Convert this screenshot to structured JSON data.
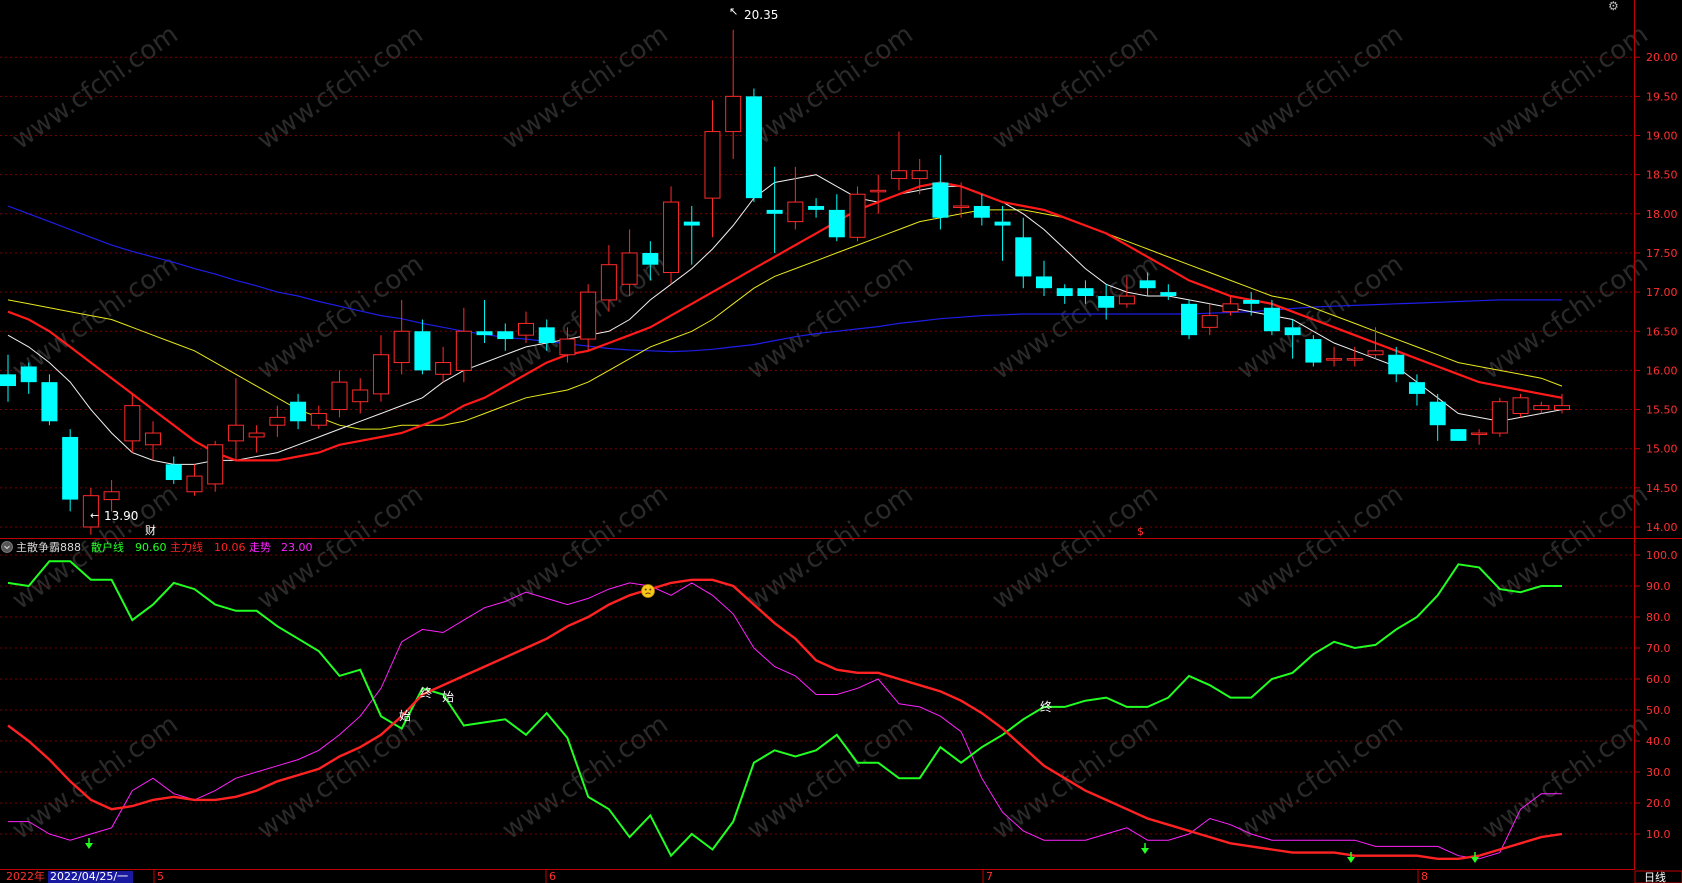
{
  "price_panel": {
    "max_label": "20.35",
    "min_label": "13.90",
    "finance_marker": "财",
    "dollar_marker": "$"
  },
  "indicator_panel": {
    "name": "主散争霸888",
    "legend": [
      {
        "label": "散户线",
        "value": "90.60",
        "color": "#22ff22"
      },
      {
        "label": "主力线",
        "value": "10.06",
        "color": "#ff2222"
      },
      {
        "label": "走势",
        "value": "23.00",
        "color": "#ff22ff"
      }
    ],
    "start_marker": "始",
    "end_marker": "终"
  },
  "time_axis": {
    "year_label": "2022年",
    "cursor_date": "2022/04/25/一",
    "month_labels": [
      "5",
      "6",
      "7",
      "8"
    ],
    "period": "日线"
  },
  "colors": {
    "up": "#ff2a2a",
    "down": "#00ffff",
    "ma5": "#f0f0f0",
    "ma10": "#ff1a1a",
    "ma20": "#e8e81a",
    "ma60": "#1e1ee8",
    "retail": "#22ff22",
    "main": "#ff2222",
    "trend": "#ff22ff",
    "axis": "#c00000"
  },
  "chart_data": [
    {
      "type": "candlestick",
      "y_ticks": [
        14.0,
        14.5,
        15.0,
        15.5,
        16.0,
        16.5,
        17.0,
        17.5,
        18.0,
        18.5,
        19.0,
        19.5,
        20.0
      ],
      "ylim": [
        13.65,
        20.45
      ],
      "candles": [
        [
          15.95,
          15.8,
          16.2,
          15.6
        ],
        [
          16.05,
          15.85,
          16.1,
          15.7
        ],
        [
          15.85,
          15.35,
          15.95,
          15.3
        ],
        [
          15.15,
          14.35,
          15.25,
          14.2
        ],
        [
          14.0,
          14.4,
          14.5,
          13.9
        ],
        [
          14.35,
          14.45,
          14.6,
          14.2
        ],
        [
          15.1,
          15.55,
          15.7,
          14.95
        ],
        [
          15.05,
          15.2,
          15.35,
          14.85
        ],
        [
          14.8,
          14.6,
          14.9,
          14.55
        ],
        [
          14.45,
          14.65,
          14.8,
          14.4
        ],
        [
          14.55,
          15.05,
          15.1,
          14.45
        ],
        [
          15.1,
          15.3,
          15.9,
          14.85
        ],
        [
          15.15,
          15.2,
          15.3,
          14.95
        ],
        [
          15.3,
          15.4,
          15.55,
          15.15
        ],
        [
          15.6,
          15.35,
          15.7,
          15.25
        ],
        [
          15.3,
          15.45,
          15.55,
          15.25
        ],
        [
          15.5,
          15.85,
          16.0,
          15.4
        ],
        [
          15.6,
          15.75,
          15.9,
          15.45
        ],
        [
          15.7,
          16.2,
          16.45,
          15.6
        ],
        [
          16.1,
          16.5,
          16.9,
          15.95
        ],
        [
          16.5,
          16.0,
          16.65,
          15.95
        ],
        [
          15.95,
          16.1,
          16.3,
          15.85
        ],
        [
          16.0,
          16.5,
          16.8,
          15.85
        ],
        [
          16.5,
          16.45,
          16.9,
          16.35
        ],
        [
          16.5,
          16.4,
          16.6,
          16.25
        ],
        [
          16.45,
          16.6,
          16.75,
          16.35
        ],
        [
          16.55,
          16.35,
          16.65,
          16.25
        ],
        [
          16.2,
          16.4,
          16.55,
          16.1
        ],
        [
          16.4,
          17.0,
          17.1,
          16.25
        ],
        [
          16.9,
          17.35,
          17.6,
          16.75
        ],
        [
          17.1,
          17.5,
          17.8,
          16.95
        ],
        [
          17.5,
          17.35,
          17.65,
          17.15
        ],
        [
          17.25,
          18.15,
          18.35,
          17.1
        ],
        [
          17.9,
          17.85,
          18.1,
          17.35
        ],
        [
          18.2,
          19.05,
          19.45,
          17.7
        ],
        [
          19.05,
          19.5,
          20.35,
          18.7
        ],
        [
          19.5,
          18.2,
          19.6,
          18.15
        ],
        [
          18.05,
          18.0,
          18.6,
          17.5
        ],
        [
          17.9,
          18.15,
          18.6,
          17.8
        ],
        [
          18.1,
          18.05,
          18.2,
          17.95
        ],
        [
          18.05,
          17.7,
          18.25,
          17.65
        ],
        [
          17.7,
          18.25,
          18.35,
          17.65
        ],
        [
          18.3,
          18.3,
          18.5,
          18.0
        ],
        [
          18.45,
          18.55,
          19.05,
          18.3
        ],
        [
          18.45,
          18.55,
          18.7,
          18.25
        ],
        [
          18.4,
          17.95,
          18.75,
          17.8
        ],
        [
          18.1,
          18.1,
          18.4,
          17.95
        ],
        [
          18.1,
          17.95,
          18.25,
          17.85
        ],
        [
          17.9,
          17.85,
          18.1,
          17.4
        ],
        [
          17.7,
          17.2,
          17.95,
          17.05
        ],
        [
          17.2,
          17.05,
          17.4,
          16.95
        ],
        [
          17.05,
          16.95,
          17.1,
          16.85
        ],
        [
          17.05,
          16.95,
          17.15,
          16.85
        ],
        [
          16.95,
          16.8,
          17.1,
          16.65
        ],
        [
          16.85,
          16.95,
          17.2,
          16.8
        ],
        [
          17.15,
          17.05,
          17.25,
          16.95
        ],
        [
          17.0,
          16.95,
          17.1,
          16.9
        ],
        [
          16.85,
          16.45,
          16.9,
          16.4
        ],
        [
          16.55,
          16.7,
          16.85,
          16.45
        ],
        [
          16.75,
          16.85,
          16.95,
          16.7
        ],
        [
          16.9,
          16.85,
          17.0,
          16.7
        ],
        [
          16.8,
          16.5,
          16.9,
          16.45
        ],
        [
          16.55,
          16.45,
          16.65,
          16.15
        ],
        [
          16.4,
          16.1,
          16.45,
          16.05
        ],
        [
          16.15,
          16.15,
          16.3,
          16.05
        ],
        [
          16.15,
          16.15,
          16.3,
          16.05
        ],
        [
          16.2,
          16.25,
          16.55,
          16.15
        ],
        [
          16.2,
          15.95,
          16.3,
          15.85
        ],
        [
          15.85,
          15.7,
          15.95,
          15.55
        ],
        [
          15.6,
          15.3,
          15.7,
          15.1
        ],
        [
          15.25,
          15.1,
          15.25,
          15.1
        ],
        [
          15.2,
          15.2,
          15.25,
          15.05
        ],
        [
          15.2,
          15.6,
          15.65,
          15.15
        ],
        [
          15.45,
          15.65,
          15.7,
          15.4
        ],
        [
          15.5,
          15.55,
          15.6,
          15.45
        ],
        [
          15.5,
          15.55,
          15.7,
          15.45
        ]
      ],
      "series": [
        {
          "name": "MA5",
          "values": [
            16.45,
            16.3,
            16.1,
            15.85,
            15.5,
            15.2,
            14.95,
            14.85,
            14.8,
            14.8,
            14.85,
            14.85,
            14.9,
            14.95,
            15.05,
            15.15,
            15.25,
            15.35,
            15.45,
            15.55,
            15.65,
            15.85,
            16.0,
            16.1,
            16.2,
            16.3,
            16.35,
            16.4,
            16.45,
            16.5,
            16.65,
            16.9,
            17.1,
            17.3,
            17.55,
            17.85,
            18.2,
            18.4,
            18.45,
            18.5,
            18.35,
            18.2,
            18.15,
            18.25,
            18.3,
            18.35,
            18.35,
            18.25,
            18.15,
            18.0,
            17.8,
            17.55,
            17.3,
            17.1,
            17.0,
            16.95,
            16.95,
            16.9,
            16.85,
            16.8,
            16.75,
            16.7,
            16.65,
            16.5,
            16.35,
            16.25,
            16.15,
            16.05,
            15.85,
            15.65,
            15.45,
            15.4,
            15.35,
            15.4,
            15.45,
            15.5
          ]
        },
        {
          "name": "MA10",
          "values": [
            16.75,
            16.65,
            16.5,
            16.3,
            16.1,
            15.9,
            15.7,
            15.5,
            15.3,
            15.1,
            14.95,
            14.85,
            14.85,
            14.85,
            14.9,
            14.95,
            15.05,
            15.1,
            15.15,
            15.2,
            15.3,
            15.4,
            15.55,
            15.65,
            15.8,
            15.95,
            16.1,
            16.2,
            16.25,
            16.35,
            16.45,
            16.55,
            16.7,
            16.85,
            17.0,
            17.15,
            17.3,
            17.45,
            17.6,
            17.75,
            17.9,
            18.05,
            18.15,
            18.25,
            18.35,
            18.4,
            18.35,
            18.25,
            18.15,
            18.1,
            18.05,
            17.95,
            17.85,
            17.75,
            17.6,
            17.45,
            17.3,
            17.15,
            17.05,
            16.95,
            16.9,
            16.85,
            16.75,
            16.65,
            16.55,
            16.45,
            16.35,
            16.25,
            16.15,
            16.05,
            15.95,
            15.85,
            15.8,
            15.75,
            15.7,
            15.65
          ]
        },
        {
          "name": "MA20",
          "values": [
            16.9,
            16.85,
            16.8,
            16.75,
            16.7,
            16.65,
            16.55,
            16.45,
            16.35,
            16.25,
            16.1,
            15.95,
            15.8,
            15.65,
            15.5,
            15.4,
            15.3,
            15.25,
            15.25,
            15.3,
            15.3,
            15.3,
            15.35,
            15.45,
            15.55,
            15.65,
            15.7,
            15.75,
            15.85,
            16.0,
            16.15,
            16.3,
            16.4,
            16.5,
            16.65,
            16.85,
            17.05,
            17.2,
            17.3,
            17.4,
            17.5,
            17.6,
            17.7,
            17.8,
            17.9,
            17.95,
            18.0,
            18.05,
            18.05,
            18.05,
            18.0,
            17.95,
            17.85,
            17.75,
            17.65,
            17.55,
            17.45,
            17.35,
            17.25,
            17.15,
            17.05,
            16.95,
            16.9,
            16.8,
            16.7,
            16.6,
            16.5,
            16.4,
            16.3,
            16.2,
            16.1,
            16.05,
            16.0,
            15.95,
            15.9,
            15.8
          ]
        },
        {
          "name": "MA60",
          "values": [
            18.1,
            18.0,
            17.9,
            17.8,
            17.7,
            17.6,
            17.52,
            17.45,
            17.38,
            17.3,
            17.23,
            17.15,
            17.08,
            17.0,
            16.95,
            16.88,
            16.82,
            16.76,
            16.7,
            16.66,
            16.6,
            16.55,
            16.5,
            16.46,
            16.42,
            16.4,
            16.37,
            16.34,
            16.31,
            16.28,
            16.26,
            16.25,
            16.24,
            16.25,
            16.27,
            16.3,
            16.33,
            16.38,
            16.43,
            16.47,
            16.5,
            16.53,
            16.56,
            16.6,
            16.63,
            16.66,
            16.68,
            16.7,
            16.71,
            16.72,
            16.72,
            16.72,
            16.72,
            16.72,
            16.72,
            16.72,
            16.72,
            16.72,
            16.73,
            16.74,
            16.75,
            16.77,
            16.79,
            16.81,
            16.82,
            16.83,
            16.84,
            16.85,
            16.86,
            16.87,
            16.88,
            16.89,
            16.9,
            16.9,
            16.9,
            16.9
          ]
        }
      ]
    },
    {
      "type": "line",
      "y_ticks": [
        10.0,
        20.0,
        30.0,
        40.0,
        50.0,
        60.0,
        70.0,
        80.0,
        90.0,
        100.0
      ],
      "ylim": [
        0,
        102
      ],
      "series": [
        {
          "name": "散户线",
          "values": [
            91,
            90,
            98,
            98,
            92,
            92,
            79,
            84,
            91,
            89,
            84,
            82,
            82,
            77,
            73,
            69,
            61,
            63,
            48,
            44,
            57,
            55,
            45,
            46,
            47,
            42,
            49,
            41,
            22,
            18,
            9,
            16,
            3,
            10,
            5,
            14,
            33,
            37,
            35,
            37,
            42,
            33,
            33,
            28,
            28,
            38,
            33,
            38,
            42,
            47,
            51,
            51,
            53,
            54,
            51,
            51,
            54,
            61,
            58,
            54,
            54,
            60,
            62,
            68,
            72,
            70,
            71,
            76,
            80,
            87,
            97,
            96,
            89,
            88,
            90,
            90
          ]
        },
        {
          "name": "主力线",
          "values": [
            45,
            40,
            34,
            27,
            21,
            18,
            19,
            21,
            22,
            21,
            21,
            22,
            24,
            27,
            29,
            31,
            35,
            38,
            42,
            48,
            55,
            58,
            61,
            64,
            67,
            70,
            73,
            77,
            80,
            84,
            87,
            89,
            91,
            92,
            92,
            90,
            84,
            78,
            73,
            66,
            63,
            62,
            62,
            60,
            58,
            56,
            53,
            49,
            44,
            38,
            32,
            28,
            24,
            21,
            18,
            15,
            13,
            11,
            9,
            7,
            6,
            5,
            4,
            4,
            4,
            3,
            3,
            3,
            3,
            2,
            2,
            3,
            5,
            7,
            9,
            10
          ]
        },
        {
          "name": "走势",
          "values": [
            14,
            14,
            10,
            8,
            10,
            12,
            24,
            28,
            23,
            21,
            24,
            28,
            30,
            32,
            34,
            37,
            42,
            48,
            57,
            72,
            76,
            75,
            79,
            83,
            85,
            88,
            86,
            84,
            86,
            89,
            91,
            90,
            87,
            91,
            87,
            81,
            70,
            64,
            61,
            55,
            55,
            57,
            60,
            52,
            51,
            48,
            43,
            28,
            17,
            11,
            8,
            8,
            8,
            10,
            12,
            8,
            8,
            10,
            15,
            13,
            10,
            8,
            8,
            8,
            8,
            8,
            6,
            6,
            6,
            6,
            3,
            2,
            4,
            18,
            23,
            23
          ]
        }
      ]
    }
  ]
}
